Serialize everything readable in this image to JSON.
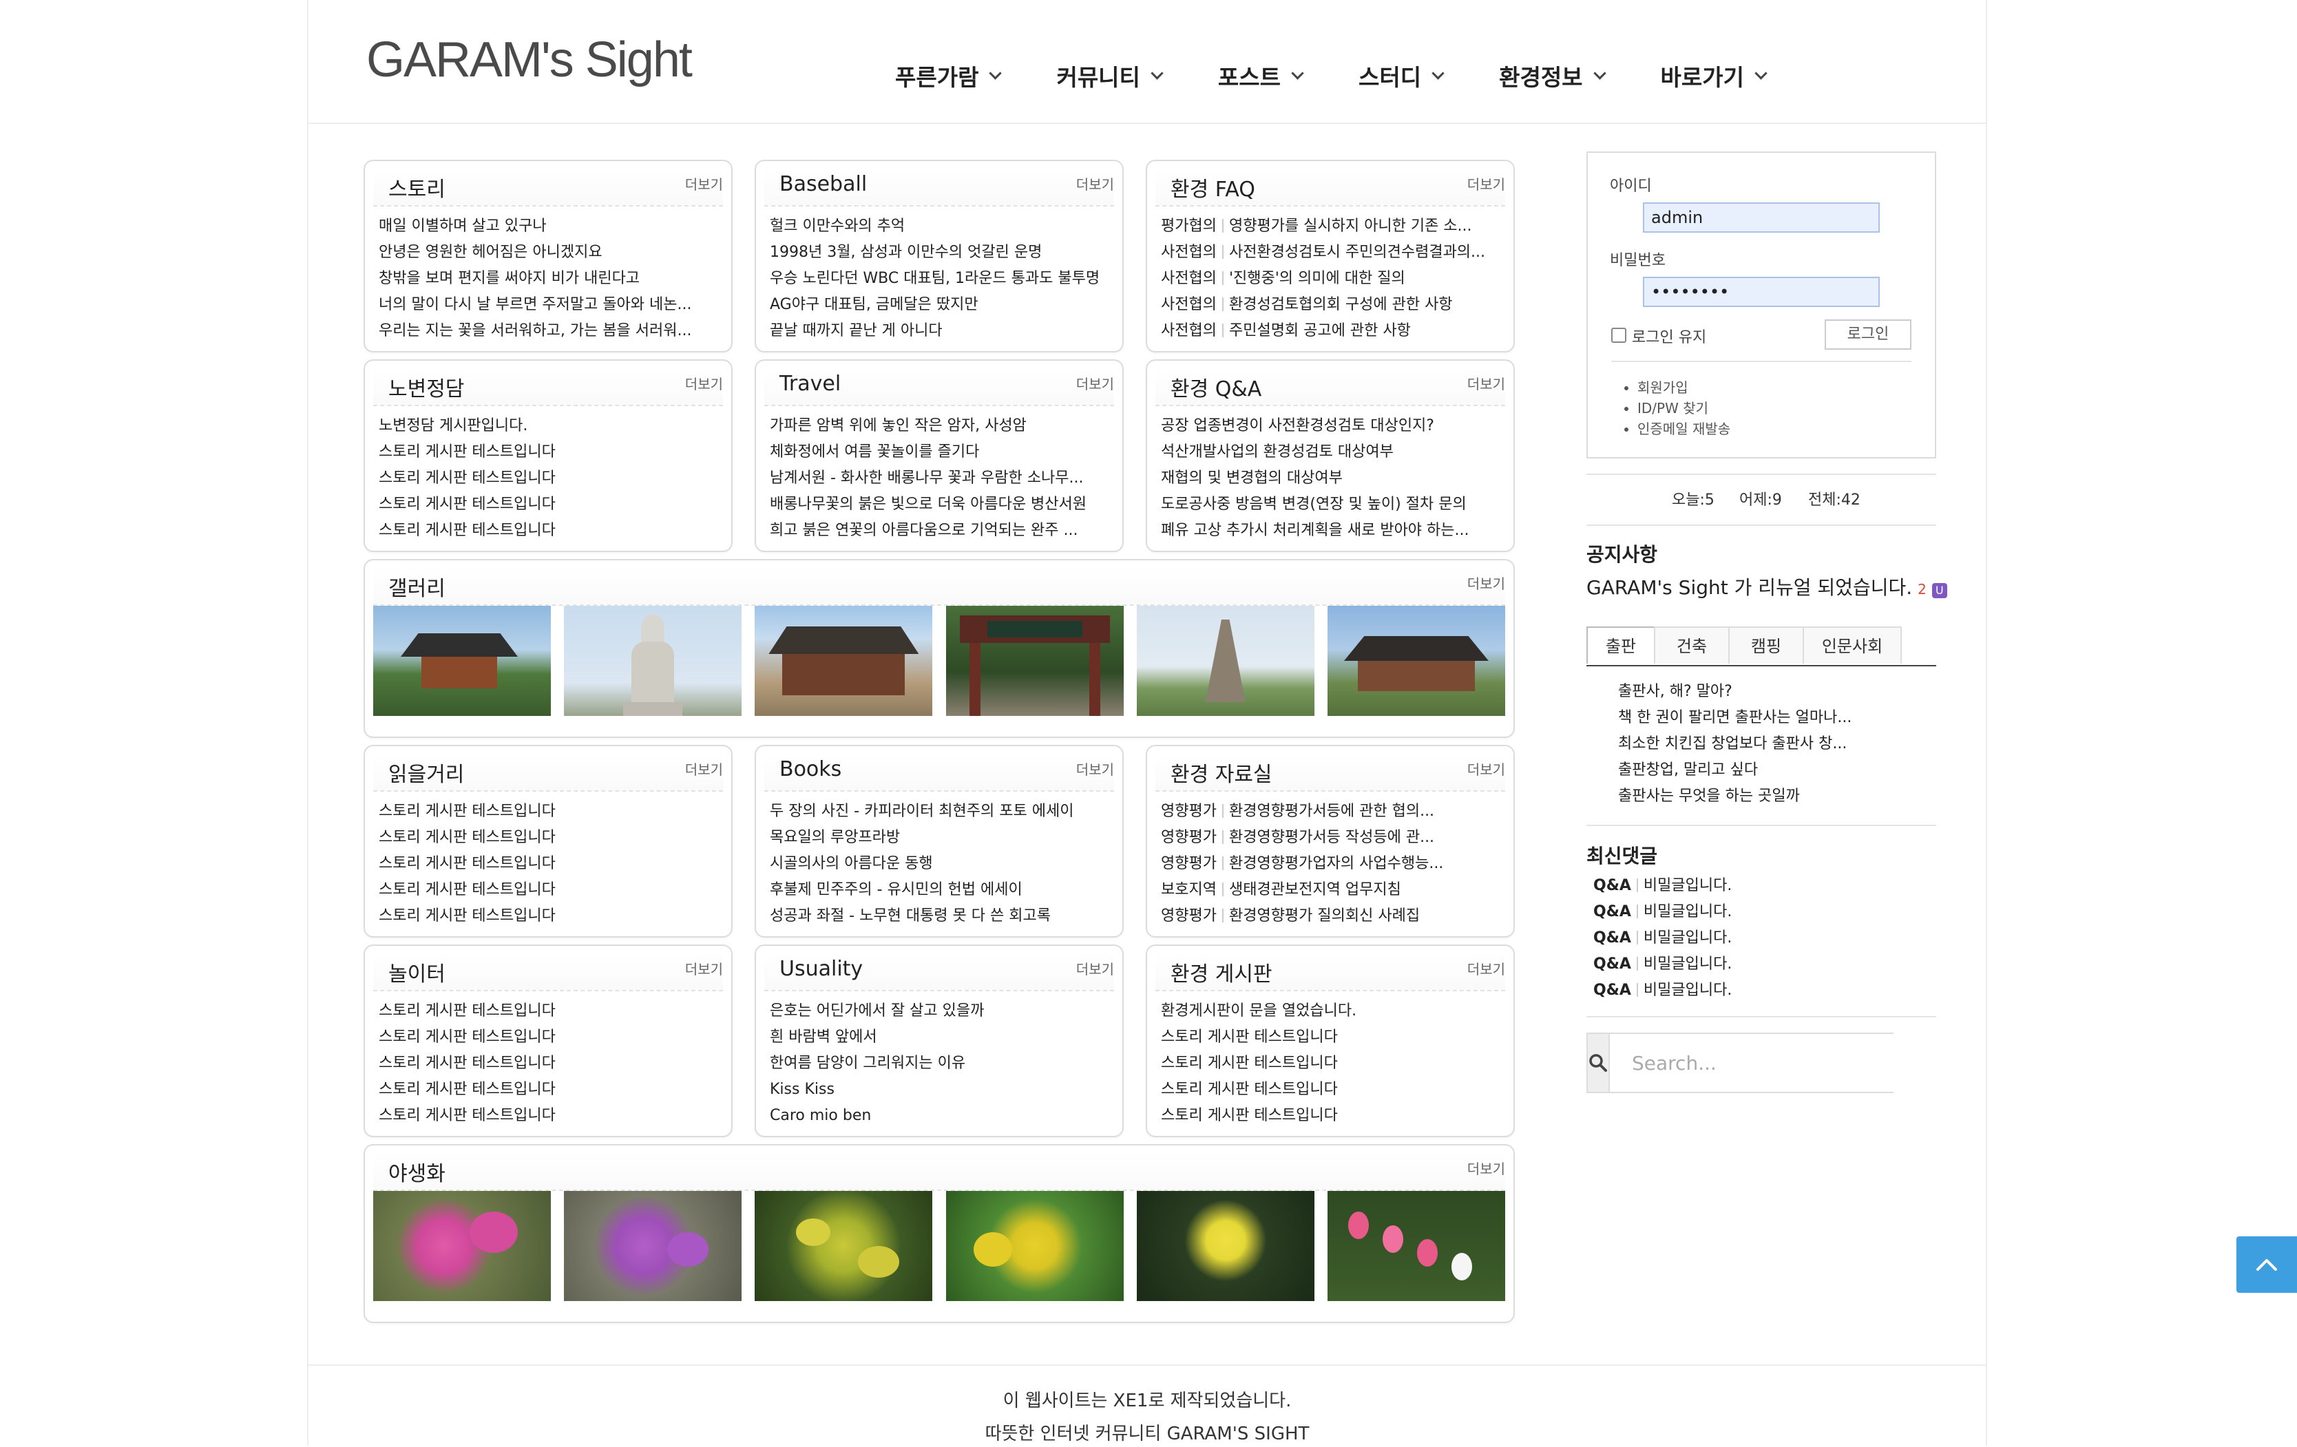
{
  "header": {
    "logo": "GARAM's Sight",
    "nav": [
      "푸른가람",
      "커뮤니티",
      "포스트",
      "스터디",
      "환경정보",
      "바로가기"
    ]
  },
  "more_label": "더보기",
  "panels": {
    "story": {
      "title": "스토리",
      "items": [
        "매일 이별하며 살고 있구나",
        "안녕은 영원한 헤어짐은 아니겠지요",
        "창밖을 보며 편지를 써야지 비가 내린다고",
        "너의 말이 다시 날 부르면 주저말고 돌아와 네논...",
        "우리는 지는 꽃을 서러워하고, 가는 봄을 서러워..."
      ]
    },
    "baseball": {
      "title": "Baseball",
      "items": [
        "헐크 이만수와의 추억",
        "1998년 3월, 삼성과 이만수의 엇갈린 운명",
        "우승 노린다던 WBC 대표팀, 1라운드 통과도 불투명",
        "AG야구 대표팀, 금메달은 땄지만",
        "끝날 때까지 끝난 게 아니다"
      ]
    },
    "env_faq": {
      "title": "환경 FAQ",
      "items": [
        {
          "p": "평가협의",
          "t": "영향평가를 실시하지 아니한 기존 소..."
        },
        {
          "p": "사전협의",
          "t": "사전환경성검토시 주민의견수렴결과의..."
        },
        {
          "p": "사전협의",
          "t": "'진행중'의 의미에 대한 질의"
        },
        {
          "p": "사전협의",
          "t": "환경성검토협의회 구성에 관한 사항"
        },
        {
          "p": "사전협의",
          "t": "주민설명회 공고에 관한 사항"
        }
      ]
    },
    "nobyeon": {
      "title": "노변정담",
      "items": [
        "노변정담 게시판입니다.",
        "스토리 게시판 테스트입니다",
        "스토리 게시판 테스트입니다",
        "스토리 게시판 테스트입니다",
        "스토리 게시판 테스트입니다"
      ]
    },
    "travel": {
      "title": "Travel",
      "items": [
        "가파른 암벽 위에 놓인 작은 암자, 사성암",
        "체화정에서 여름 꽃놀이를 즐기다",
        "남계서원 - 화사한 배롱나무 꽃과 우람한 소나무...",
        "배롱나무꽃의 붉은 빛으로 더욱 아름다운 병산서원",
        "희고 붉은 연꽃의 아름다움으로 기억되는 완주 ..."
      ]
    },
    "env_qna": {
      "title": "환경 Q&A",
      "items": [
        "공장 업종변경이 사전환경성검토 대상인지?",
        "석산개발사업의 환경성검토 대상여부",
        "재협의 및 변경협의 대상여부",
        "도로공사중 방음벽 변경(연장 및 높이) 절차 문의",
        "폐유 고상 추가시 처리계획을 새로 받아야 하는..."
      ]
    },
    "gallery": {
      "title": "갤러리"
    },
    "reading": {
      "title": "읽을거리",
      "items": [
        "스토리 게시판 테스트입니다",
        "스토리 게시판 테스트입니다",
        "스토리 게시판 테스트입니다",
        "스토리 게시판 테스트입니다",
        "스토리 게시판 테스트입니다"
      ]
    },
    "books": {
      "title": "Books",
      "items": [
        "두 장의 사진 - 카피라이터 최현주의 포토 에세이",
        "목요일의 루앙프라방",
        "시골의사의 아름다운 동행",
        "후불제 민주주의 - 유시민의 헌법 에세이",
        "성공과 좌절 - 노무현 대통령 못 다 쓴 회고록"
      ]
    },
    "env_data": {
      "title": "환경 자료실",
      "items": [
        {
          "p": "영향평가",
          "t": "환경영향평가서등에 관한 협의..."
        },
        {
          "p": "영향평가",
          "t": "환경영향평가서등 작성등에 관..."
        },
        {
          "p": "영향평가",
          "t": "환경영향평가업자의 사업수행능..."
        },
        {
          "p": "보호지역",
          "t": "생태경관보전지역 업무지침"
        },
        {
          "p": "영향평가",
          "t": "환경영향평가 질의회신 사례집"
        }
      ]
    },
    "playground": {
      "title": "놀이터",
      "items": [
        "스토리 게시판 테스트입니다",
        "스토리 게시판 테스트입니다",
        "스토리 게시판 테스트입니다",
        "스토리 게시판 테스트입니다",
        "스토리 게시판 테스트입니다"
      ]
    },
    "usuality": {
      "title": "Usuality",
      "items": [
        "은호는 어딘가에서 잘 살고 있을까",
        "흰 바람벽 앞에서",
        "한여름 담양이 그리워지는 이유",
        "Kiss Kiss",
        "Caro mio ben"
      ]
    },
    "env_board": {
      "title": "환경 게시판",
      "items": [
        "환경게시판이 문을 열었습니다.",
        "스토리 게시판 테스트입니다",
        "스토리 게시판 테스트입니다",
        "스토리 게시판 테스트입니다",
        "스토리 게시판 테스트입니다"
      ]
    },
    "wildflower": {
      "title": "야생화"
    }
  },
  "login": {
    "id_label": "아이디",
    "id_value": "admin",
    "pw_label": "비밀번호",
    "pw_value": "••••••••",
    "keep_label": "로그인 유지",
    "login_button": "로그인",
    "links": [
      "회원가입",
      "ID/PW 찾기",
      "인증메일 재발송"
    ]
  },
  "counter": {
    "today": "오늘:5",
    "yesterday": "어제:9",
    "total": "전체:42"
  },
  "notice": {
    "title": "공지사항",
    "text": "GARAM's Sight 가 리뉴얼 되었습니다.",
    "count": "2",
    "badge": "U"
  },
  "tabs": {
    "labels": [
      "출판",
      "건축",
      "캠핑",
      "인문사회"
    ],
    "active": "출판",
    "items": [
      "출판사, 해? 말아?",
      "책 한 권이 팔리면 출판사는 얼마나...",
      "최소한 치킨집 창업보다 출판사 창...",
      "출판창업, 말리고 싶다",
      "출판사는 무엇을 하는 곳일까"
    ]
  },
  "comments": {
    "title": "최신댓글",
    "items": [
      {
        "cat": "Q&A",
        "text": "비밀글입니다."
      },
      {
        "cat": "Q&A",
        "text": "비밀글입니다."
      },
      {
        "cat": "Q&A",
        "text": "비밀글입니다."
      },
      {
        "cat": "Q&A",
        "text": "비밀글입니다."
      },
      {
        "cat": "Q&A",
        "text": "비밀글입니다."
      }
    ]
  },
  "search": {
    "placeholder": "Search..."
  },
  "footer": {
    "line1": "이 웹사이트는 XE1로 제작되었습니다.",
    "line2": "따뜻한 인터넷 커뮤니티 GARAM'S SIGHT"
  },
  "colors": {
    "accent": "#3e9fe0",
    "badge": "#7e57c2",
    "count": "#e0453a"
  }
}
